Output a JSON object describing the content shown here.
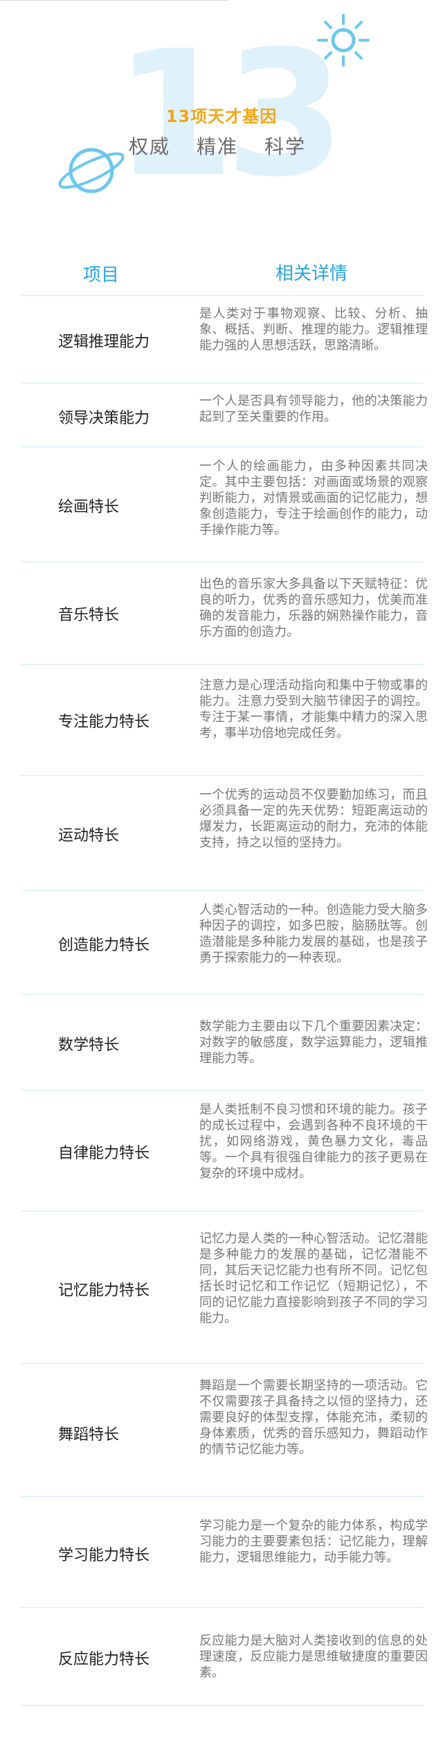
{
  "hero": {
    "number": "13",
    "title": "13项天才基因",
    "subtitle": [
      "权威",
      "精准",
      "科学"
    ]
  },
  "table": {
    "header_item": "项目",
    "header_detail": "相关详情",
    "rows": [
      {
        "name": "逻辑推理能力",
        "desc": "是人类对于事物观察、比较、分析、抽象、概括、判断、推理的能力。逻辑推理能力强的人思想活跃，思路清晰。"
      },
      {
        "name": "领导决策能力",
        "desc": "一个人是否具有领导能力，他的决策能力起到了至关重要的作用。"
      },
      {
        "name": "绘画特长",
        "desc": "一个人的绘画能力，由多种因素共同决定。其中主要包括：对画面或场景的观察判断能力，对情景或画面的记忆能力，想象创造能力，专注于绘画创作的能力，动手操作能力等。"
      },
      {
        "name": "音乐特长",
        "desc": "出色的音乐家大多具备以下天赋特征：优良的听力，优秀的音乐感知力，优美而准确的发音能力，乐器的娴熟操作能力，音乐方面的创造力。"
      },
      {
        "name": "专注能力特长",
        "desc": "注意力是心理活动指向和集中于物或事的能力。注意力受到大脑节律因子的调控。专注于某一事情，才能集中精力的深入思考，事半功倍地完成任务。"
      },
      {
        "name": "运动特长",
        "desc": "一个优秀的运动员不仅要勤加练习，而且必须具备一定的先天优势：短距离运动的爆发力，长距离运动的耐力，充沛的体能支持，持之以恒的坚持力。"
      },
      {
        "name": "创造能力特长",
        "desc": "人类心智活动的一种。创造能力受大脑多种因子的调控，如多巴胺，脑肠肽等。创造潜能是多种能力发展的基础，也是孩子勇于探索能力的一种表现。"
      },
      {
        "name": "数学特长",
        "desc": "数学能力主要由以下几个重要因素决定：对数字的敏感度，数学运算能力，逻辑推理能力等。"
      },
      {
        "name": "自律能力特长",
        "desc": "是人类抵制不良习惯和环境的能力。孩子的成长过程中，会遇到各种不良环境的干扰，如网络游戏，黄色暴力文化，毒品等。一个具有很强自律能力的孩子更易在复杂的环境中成材。"
      },
      {
        "name": "记忆能力特长",
        "desc": "记忆力是人类的一种心智活动。记忆潜能是多种能力的发展的基础，记忆潜能不同，其后天记忆能力也有所不同。记忆包括长时记忆和工作记忆（短期记忆），不同的记忆能力直接影响到孩子不同的学习能力。"
      },
      {
        "name": "舞蹈特长",
        "desc": "舞蹈是一个需要长期坚持的一项活动。它不仅需要孩子具备持之以恒的坚持力，还需要良好的体型支撑，体能充沛，柔韧的身体素质，优秀的音乐感知力，舞蹈动作的情节记忆能力等。"
      },
      {
        "name": "学习能力特长",
        "desc": " 学习能力是一个复杂的能力体系，构成学习能力的主要要素包括：记忆能力，理解能力，逻辑思维能力，动手能力等。"
      },
      {
        "name": "反应能力特长",
        "desc": "反应能力是大脑对人类接收到的信息的处理速度，反应能力是思维敏捷度的重要因素。"
      }
    ]
  },
  "colors": {
    "accent_blue": "#29a3dc",
    "title_orange": "#f2a618",
    "big_number": "#dff1fb",
    "divider": "#cfeaf5"
  },
  "icons": [
    "sun-icon",
    "planet-icon"
  ]
}
